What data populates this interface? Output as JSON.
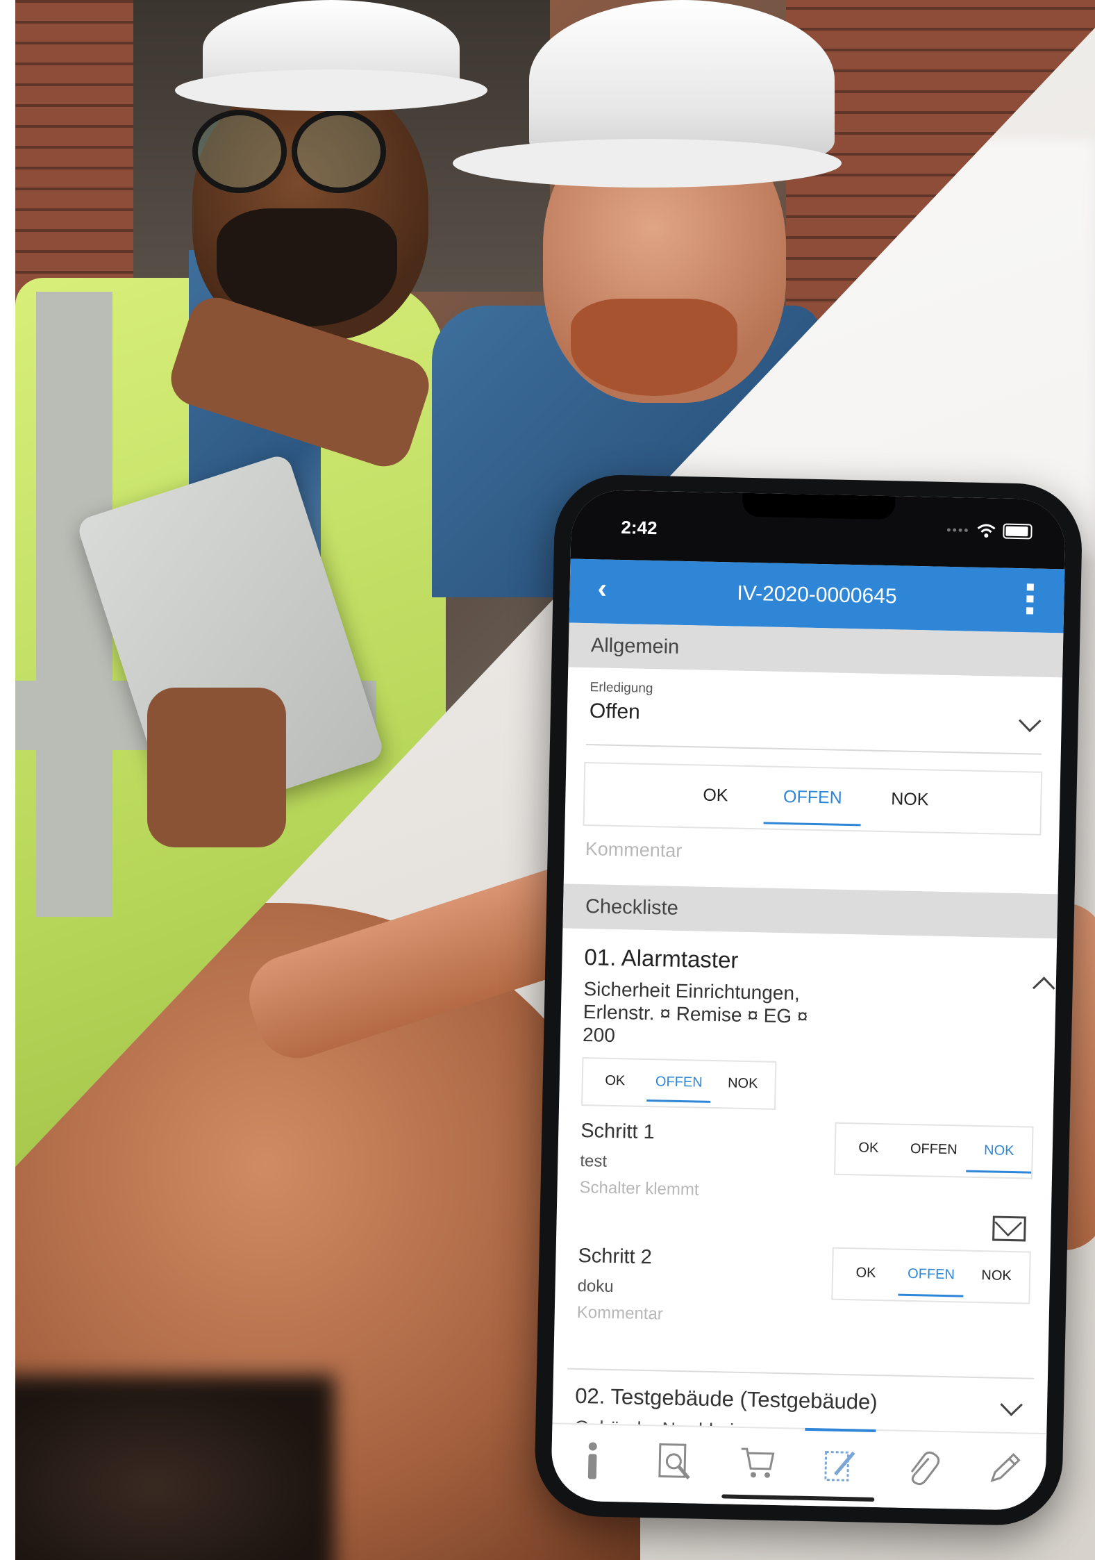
{
  "status": {
    "time": "2:42"
  },
  "appbar": {
    "title": "IV-2020-0000645"
  },
  "allgemein": {
    "header": "Allgemein",
    "erledigung_label": "Erledigung",
    "erledigung_value": "Offen",
    "segments": [
      "OK",
      "OFFEN",
      "NOK"
    ],
    "comment_placeholder": "Kommentar"
  },
  "checkliste": {
    "header": "Checkliste",
    "item1": {
      "title": "01. Alarmtaster",
      "subtitle": "Sicherheit Einrichtungen, Erlenstr. ¤ Remise ¤ EG ¤ 200",
      "segments": [
        "OK",
        "OFFEN",
        "NOK"
      ]
    },
    "steps": [
      {
        "title": "Schritt 1",
        "desc": "test",
        "comment": "Schalter klemmt",
        "segments": [
          "OK",
          "OFFEN",
          "NOK"
        ]
      },
      {
        "title": "Schritt 2",
        "desc": "doku",
        "comment": "Kommentar",
        "segments": [
          "OK",
          "OFFEN",
          "NOK"
        ]
      }
    ],
    "item2": {
      "title": "02. Testgebäude (Testgebäude)",
      "subtitle": "Gebäude, Nordrhein-"
    }
  },
  "tabbar": {
    "icons": [
      "info-icon",
      "document-search-icon",
      "cart-icon",
      "checklist-edit-icon",
      "paperclip-icon",
      "pencil-icon"
    ]
  },
  "colors": {
    "accent": "#2f86d6",
    "vest": "#c9e36a"
  }
}
